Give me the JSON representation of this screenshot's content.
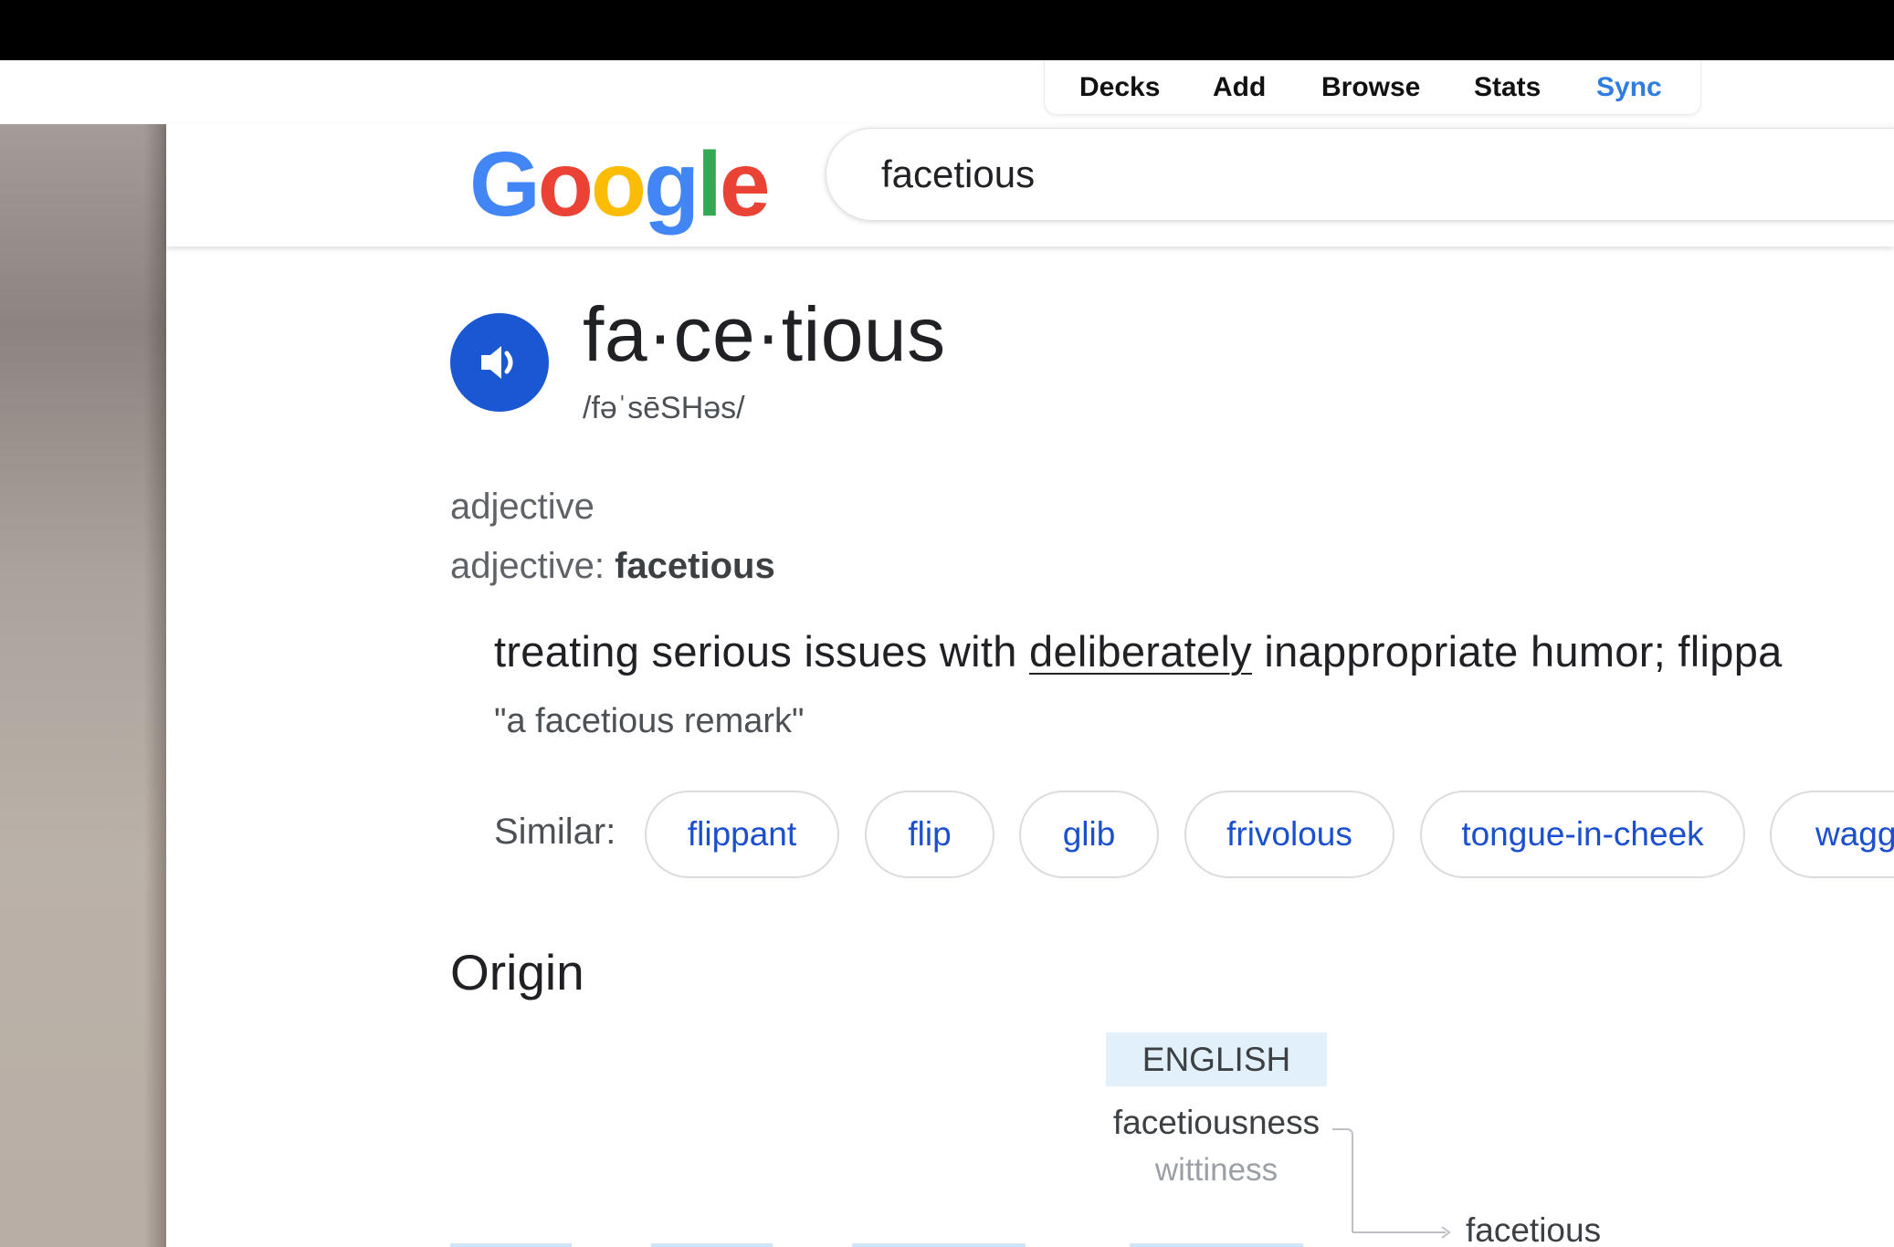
{
  "anki_menu": {
    "items": [
      "Decks",
      "Add",
      "Browse",
      "Stats",
      "Sync"
    ],
    "active_color": "#2f7de1"
  },
  "google": {
    "logo_letters": [
      "G",
      "o",
      "o",
      "g",
      "l",
      "e"
    ],
    "search_value": "facetious"
  },
  "entry": {
    "headword": "fa·ce·tious",
    "phonetic": "/fəˈsēSHəs/",
    "part_of_speech": "adjective",
    "pos_label": "adjective: ",
    "pos_word": "facetious",
    "definition_before": "treating serious issues with ",
    "definition_link": "deliberately",
    "definition_after": " inappropriate humor; flippa",
    "example": "\"a facetious remark\"",
    "similar_label": "Similar:",
    "similar": [
      "flippant",
      "flip",
      "glib",
      "frivolous",
      "tongue-in-cheek",
      "wagg"
    ]
  },
  "origin": {
    "title": "Origin",
    "language": "ENGLISH",
    "word1": "facetiousness",
    "word1_gloss": "wittiness",
    "word2": "facetious"
  },
  "icons": {
    "speaker": "speaker-icon",
    "arrow": "arrow-right-icon"
  }
}
